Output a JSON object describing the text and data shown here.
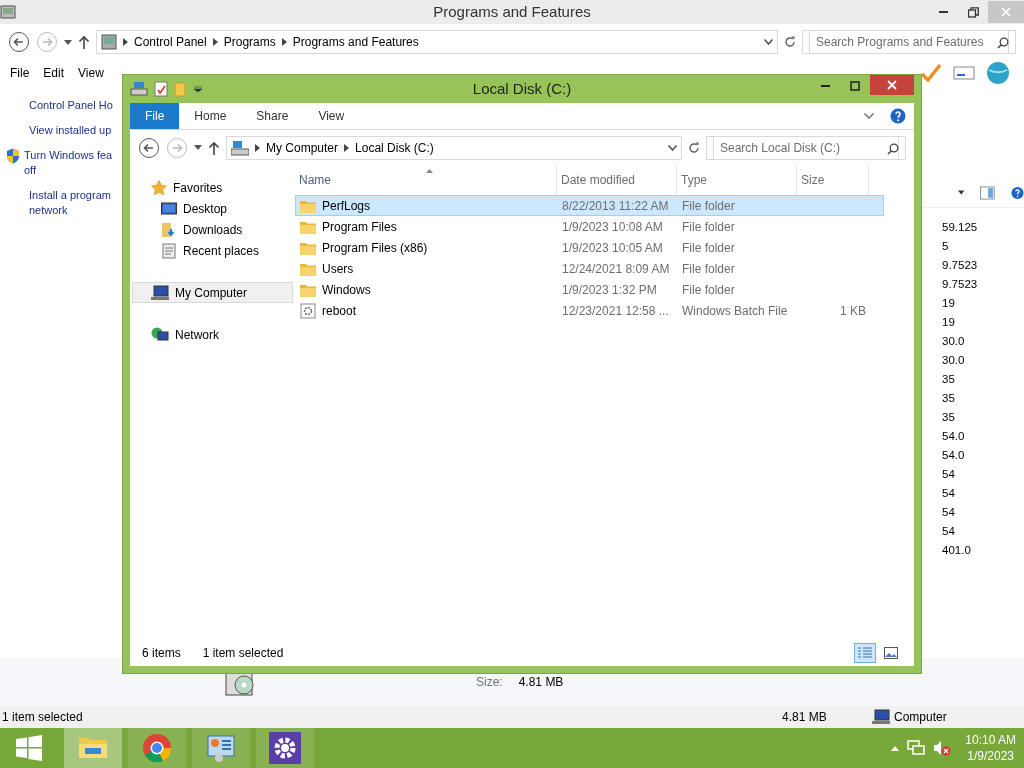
{
  "background_window": {
    "title": "Programs and Features",
    "crumbs": [
      "Control Panel",
      "Programs",
      "Programs and Features"
    ],
    "search_placeholder": "Search Programs and Features",
    "menu": [
      "File",
      "Edit",
      "View"
    ],
    "sidebar_links": [
      {
        "lines": [
          "Control Panel Ho"
        ],
        "kind": "plain"
      },
      {
        "lines": [
          "View installed up"
        ],
        "kind": "plain"
      },
      {
        "lines": [
          "Turn Windows fea",
          "off"
        ],
        "kind": "shield"
      },
      {
        "lines": [
          "Install a program",
          "network"
        ],
        "kind": "plain"
      }
    ],
    "column_values": [
      "59.125",
      "5",
      "9.7523",
      "9.7523",
      "19",
      "19",
      "30.0",
      "30.0",
      "35",
      "35",
      "35",
      "54.0",
      "54.0",
      "54",
      "54",
      "54",
      "54",
      "401.0"
    ],
    "details": {
      "label": "Size:",
      "value": "4.81 MB"
    },
    "status": {
      "text": "1 item selected",
      "size": "4.81 MB",
      "zone": "Computer"
    }
  },
  "explorer_window": {
    "title": "Local Disk (C:)",
    "ribbon_tabs": [
      {
        "label": "File",
        "selected": true
      },
      {
        "label": "Home",
        "selected": false
      },
      {
        "label": "Share",
        "selected": false
      },
      {
        "label": "View",
        "selected": false
      }
    ],
    "crumbs": [
      "My Computer",
      "Local Disk (C:)"
    ],
    "search_placeholder": "Search Local Disk (C:)",
    "navigation": [
      {
        "label": "Favorites",
        "kind": "star",
        "selected": false,
        "children": [
          {
            "label": "Desktop",
            "kind": "desktop",
            "selected": false
          },
          {
            "label": "Downloads",
            "kind": "downloads",
            "selected": false
          },
          {
            "label": "Recent places",
            "kind": "recent",
            "selected": false
          }
        ]
      },
      {
        "label": "My Computer",
        "kind": "computer",
        "selected": true
      },
      {
        "label": "Network",
        "kind": "network",
        "selected": false
      }
    ],
    "columns": [
      {
        "label": "Name",
        "sorted": true
      },
      {
        "label": "Date modified",
        "sorted": false
      },
      {
        "label": "Type",
        "sorted": false
      },
      {
        "label": "Size",
        "sorted": false
      }
    ],
    "rows": [
      {
        "name": "PerfLogs",
        "date": "8/22/2013 11:22 AM",
        "type": "File folder",
        "kind": "folder",
        "selected": true
      },
      {
        "name": "Program Files",
        "date": "1/9/2023 10:08 AM",
        "type": "File folder",
        "kind": "folder",
        "selected": false
      },
      {
        "name": "Program Files (x86)",
        "date": "1/9/2023 10:05 AM",
        "type": "File folder",
        "kind": "folder",
        "selected": false
      },
      {
        "name": "Users",
        "date": "12/24/2021 8:09 AM",
        "type": "File folder",
        "kind": "folder",
        "selected": false
      },
      {
        "name": "Windows",
        "date": "1/9/2023 1:32 PM",
        "type": "File folder",
        "kind": "folder",
        "selected": false
      },
      {
        "name": "reboot",
        "date": "12/23/2021 12:58 ...",
        "type": "Windows Batch File",
        "size": "1 KB",
        "kind": "batch",
        "selected": false
      }
    ],
    "status": {
      "count": "6 items",
      "selection": "1 item selected"
    },
    "views": [
      {
        "kind": "details",
        "selected": true
      },
      {
        "kind": "tiles",
        "selected": false
      }
    ]
  },
  "taskbar": {
    "apps": [
      {
        "kind": "explorer",
        "active": true
      },
      {
        "kind": "chrome",
        "active": false
      },
      {
        "kind": "control",
        "active": false
      },
      {
        "kind": "settings",
        "active": false
      }
    ],
    "time": "10:10 AM",
    "date": "1/9/2023"
  }
}
